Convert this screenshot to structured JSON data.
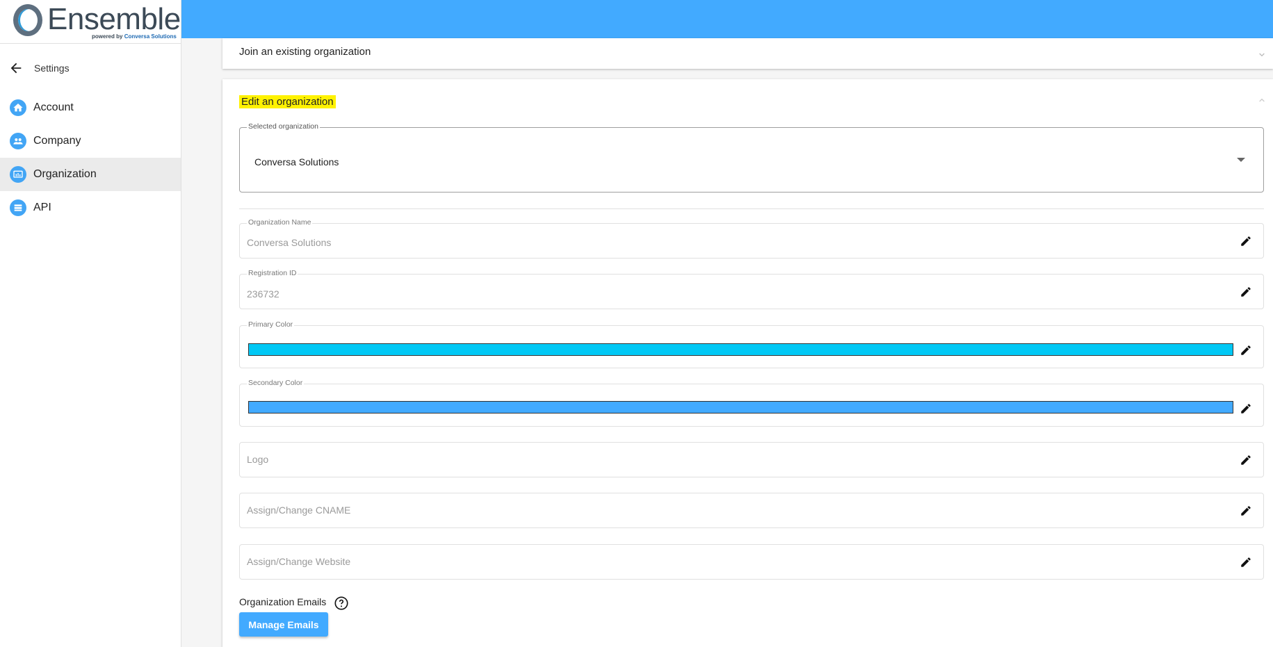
{
  "brand": {
    "name": "Ensemble",
    "tagline_prefix": "powered by",
    "tagline_company": "Conversa Solutions"
  },
  "sidebar": {
    "back_label": "Settings",
    "items": [
      {
        "label": "Account",
        "icon": "home-icon"
      },
      {
        "label": "Company",
        "icon": "people-icon"
      },
      {
        "label": "Organization",
        "icon": "organization-icon",
        "active": true
      },
      {
        "label": "API",
        "icon": "api-icon"
      }
    ]
  },
  "colors": {
    "topbar": "#42aaff",
    "primary": "#00c8f5",
    "secondary": "#42aaff",
    "highlight": "#fff200"
  },
  "panels": {
    "join": {
      "title": "Join an existing organization"
    },
    "edit": {
      "title": "Edit an organization",
      "selected_org_label": "Selected organization",
      "selected_org_value": "Conversa Solutions",
      "fields": {
        "org_name": {
          "label": "Organization Name",
          "value": "Conversa Solutions"
        },
        "registration_id": {
          "label": "Registration ID",
          "value": "236732"
        },
        "primary_color": {
          "label": "Primary Color"
        },
        "secondary_color": {
          "label": "Secondary Color"
        },
        "logo": {
          "placeholder": "Logo"
        },
        "cname": {
          "placeholder": "Assign/Change CNAME"
        },
        "website": {
          "placeholder": "Assign/Change Website"
        }
      },
      "emails_label": "Organization Emails",
      "manage_emails_button": "Manage Emails"
    }
  }
}
